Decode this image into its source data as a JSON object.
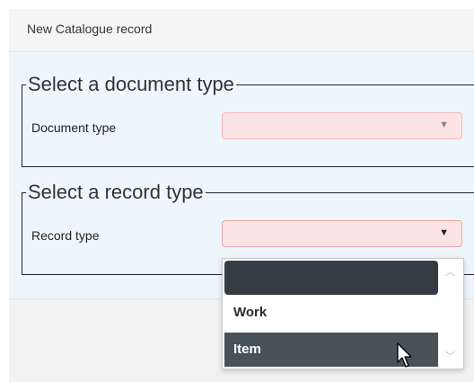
{
  "dialog": {
    "title": "New Catalogue record"
  },
  "document_section": {
    "legend": "Select a document type",
    "label": "Document type",
    "value": "",
    "caret": "▼"
  },
  "record_section": {
    "legend": "Select a record type",
    "label": "Record type",
    "value": "",
    "caret": "▼"
  },
  "dropdown": {
    "options": [
      "",
      "Work",
      "Item"
    ],
    "highlighted": "Item",
    "scroll_up": "︿",
    "scroll_down": "﹀"
  },
  "colors": {
    "required_field_bg": "#fde4e4",
    "option_highlight": "#48525b",
    "option_selected": "#343d45"
  },
  "icons": {
    "cursor": "pointer-cursor-icon"
  }
}
